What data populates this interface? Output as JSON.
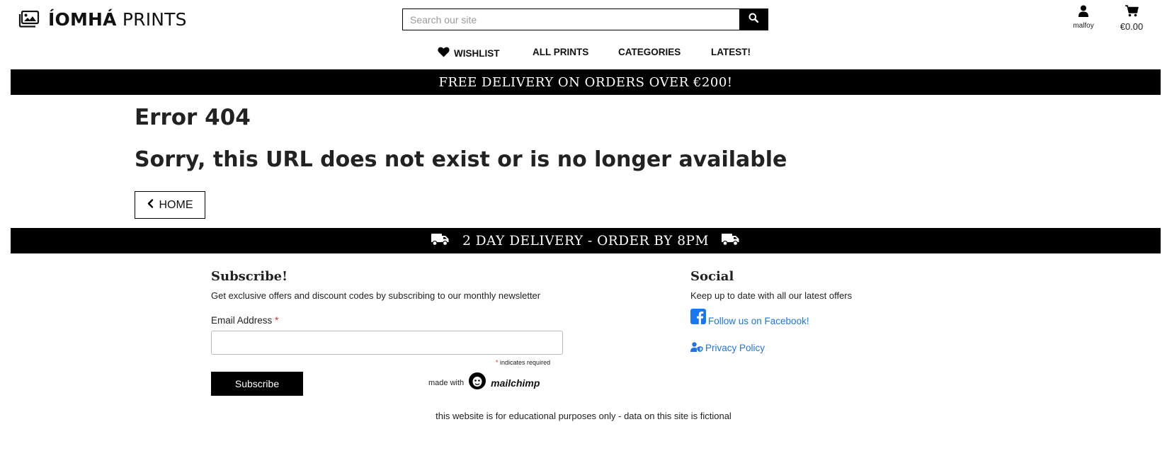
{
  "header": {
    "logo_strong": "ÍOMHÁ",
    "logo_light": "PRINTS",
    "search_placeholder": "Search our site",
    "account_label": "malfoy",
    "cart_total": "€0.00"
  },
  "nav": {
    "items": [
      {
        "label": "WISHLIST",
        "icon": "heart-icon"
      },
      {
        "label": "ALL PRINTS"
      },
      {
        "label": "CATEGORIES"
      },
      {
        "label": "LATEST!"
      }
    ]
  },
  "banners": {
    "top": "FREE DELIVERY ON ORDERS OVER €200!",
    "bottom": "2 DAY DELIVERY - ORDER BY 8PM"
  },
  "error": {
    "code": "Error 404",
    "message": "Sorry, this URL does not exist or is no longer available",
    "home_button": "HOME"
  },
  "footer": {
    "subscribe": {
      "title": "Subscribe!",
      "description": "Get exclusive offers and discount codes by subscribing to our monthly newsletter",
      "email_label": "Email Address",
      "required_star": "*",
      "email_value": "",
      "required_note": "indicates required",
      "button": "Subscribe",
      "made_with": "made with",
      "brand": "mailchimp"
    },
    "social": {
      "title": "Social",
      "description": "Keep up to date with all our latest offers",
      "facebook_link": "Follow us on Facebook!",
      "privacy_link": "Privacy Policy"
    },
    "disclaimer": "this website is for educational purposes only - data on this site is fictional"
  },
  "colors": {
    "banner_bg": "#000000",
    "link": "#1e73e8",
    "required": "#c9372c",
    "facebook": "#1877f2"
  }
}
